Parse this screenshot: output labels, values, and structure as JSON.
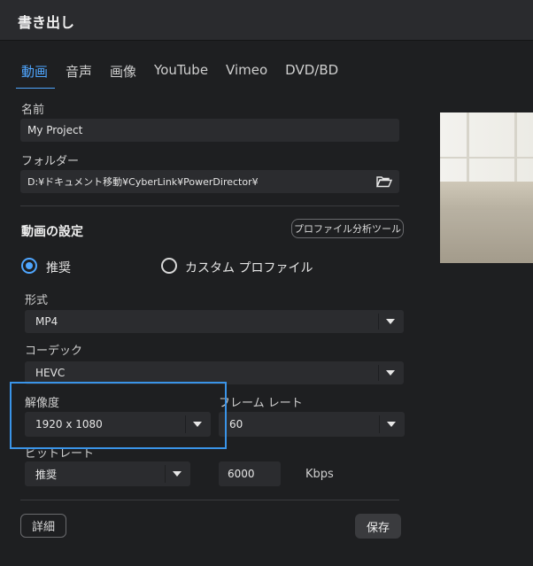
{
  "window": {
    "title": "書き出し"
  },
  "tabs": [
    {
      "label": "動画",
      "active": true
    },
    {
      "label": "音声",
      "active": false
    },
    {
      "label": "画像",
      "active": false
    },
    {
      "label": "YouTube",
      "active": false
    },
    {
      "label": "Vimeo",
      "active": false
    },
    {
      "label": "DVD/BD",
      "active": false
    }
  ],
  "name": {
    "label": "名前",
    "value": "My Project"
  },
  "folder": {
    "label": "フォルダー",
    "value": "D:¥ドキュメント移動¥CyberLink¥PowerDirector¥",
    "icon": "folder-open-icon"
  },
  "video_settings": {
    "title": "動画の設定",
    "profile_tool_label": "プロファイル分析ツール",
    "radio_recommended": {
      "label": "推奨",
      "selected": true
    },
    "radio_custom": {
      "label": "カスタム プロファイル",
      "selected": false
    },
    "format": {
      "label": "形式",
      "value": "MP4"
    },
    "codec": {
      "label": "コーデック",
      "value": "HEVC"
    },
    "resolution": {
      "label": "解像度",
      "value": "1920 x 1080"
    },
    "frame_rate": {
      "label": "フレーム レート",
      "value": "60"
    },
    "bitrate": {
      "label": "ビットレート",
      "preset": "推奨",
      "value": "6000",
      "unit": "Kbps"
    }
  },
  "buttons": {
    "detail": "詳細",
    "save": "保存"
  },
  "colors": {
    "accent": "#4fa6ff",
    "highlight_box": "#3a94e8",
    "background": "#1e1f21",
    "field": "#2b2c2f"
  }
}
